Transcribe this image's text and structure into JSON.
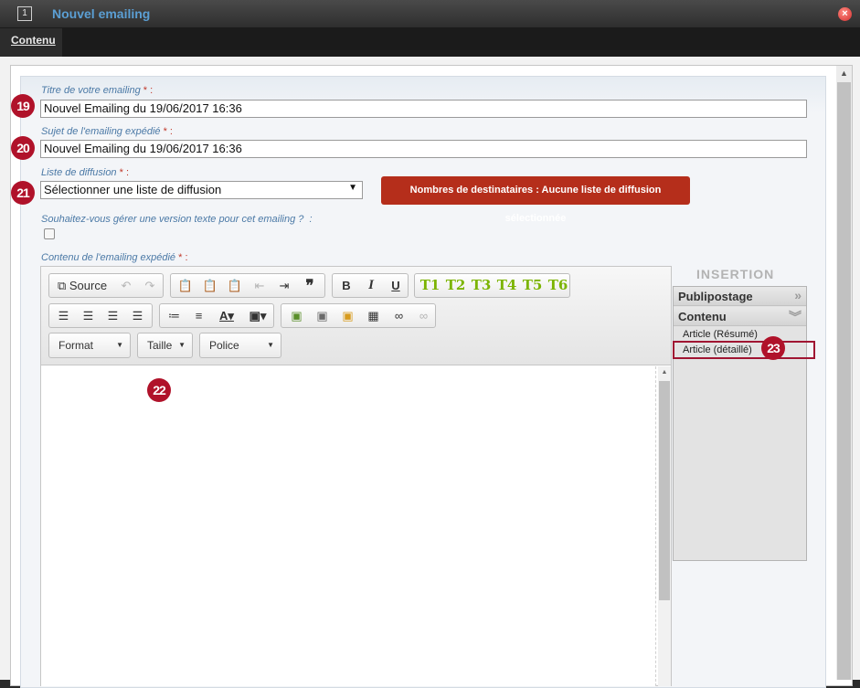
{
  "window": {
    "icon_text": "1",
    "title": "Nouvel emailing",
    "close_icon": "close-circle-icon"
  },
  "tabs": [
    {
      "label": "Contenu",
      "active": true
    }
  ],
  "form": {
    "titre": {
      "label": "Titre de votre emailing",
      "required": "* :",
      "value": "Nouvel Emailing du 19/06/2017 16:36",
      "badge": "19"
    },
    "sujet": {
      "label": "Sujet de l'emailing expédié",
      "required": "* :",
      "value": "Nouvel Emailing du 19/06/2017 16:36",
      "badge": "20"
    },
    "liste": {
      "label": "Liste de diffusion",
      "required": "* :",
      "selected": "Sélectionner une liste de diffusion",
      "badge": "21",
      "destinataires_button": "Nombres de destinataires : Aucune liste de diffusion sélectionnée"
    },
    "version_texte": {
      "label": "Souhaitez-vous gérer une version texte pour cet emailing ?",
      "suffix": ":",
      "checked": false
    },
    "contenu": {
      "label": "Contenu de l'emailing expédié",
      "required": "* :",
      "badge": "22"
    }
  },
  "editor": {
    "source_label": "Source",
    "t_buttons": [
      "T1",
      "T2",
      "T3",
      "T4",
      "T5",
      "T6"
    ],
    "combos": {
      "format": "Format",
      "taille": "Taille",
      "police": "Police"
    }
  },
  "insertion": {
    "title": "INSERTION",
    "sections": [
      {
        "label": "Publipostage",
        "icon": "double-chevron-right-icon"
      },
      {
        "label": "Contenu",
        "icon": "double-chevron-down-icon"
      }
    ],
    "items": [
      "Article (Résumé)",
      "Article (détaillé)"
    ],
    "badge": "23"
  },
  "colors": {
    "accent_blue": "#5b9fd4",
    "label_blue": "#4b79a6",
    "badge_red": "#b0122a",
    "button_red": "#b52e1b",
    "t_green": "#7bb400"
  }
}
